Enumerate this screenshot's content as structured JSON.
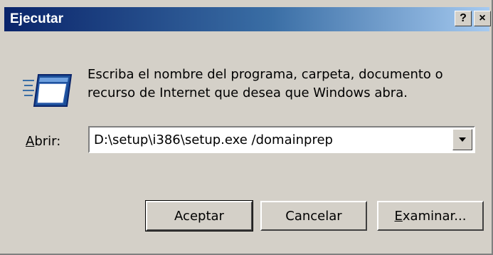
{
  "window": {
    "title": "Ejecutar",
    "help_label": "?",
    "close_label": "×"
  },
  "prompt": {
    "text_line1": "Escriba el nombre del programa, carpeta, documento o",
    "text_line2": "recurso de Internet que desea que Windows abra.",
    "icon": "run-program-icon"
  },
  "open_field": {
    "label_accel": "A",
    "label_rest": "brir:",
    "value": "D:\\setup\\i386\\setup.exe /domainprep"
  },
  "buttons": {
    "ok": "Aceptar",
    "cancel": "Cancelar",
    "browse_accel": "E",
    "browse_rest": "xaminar..."
  }
}
